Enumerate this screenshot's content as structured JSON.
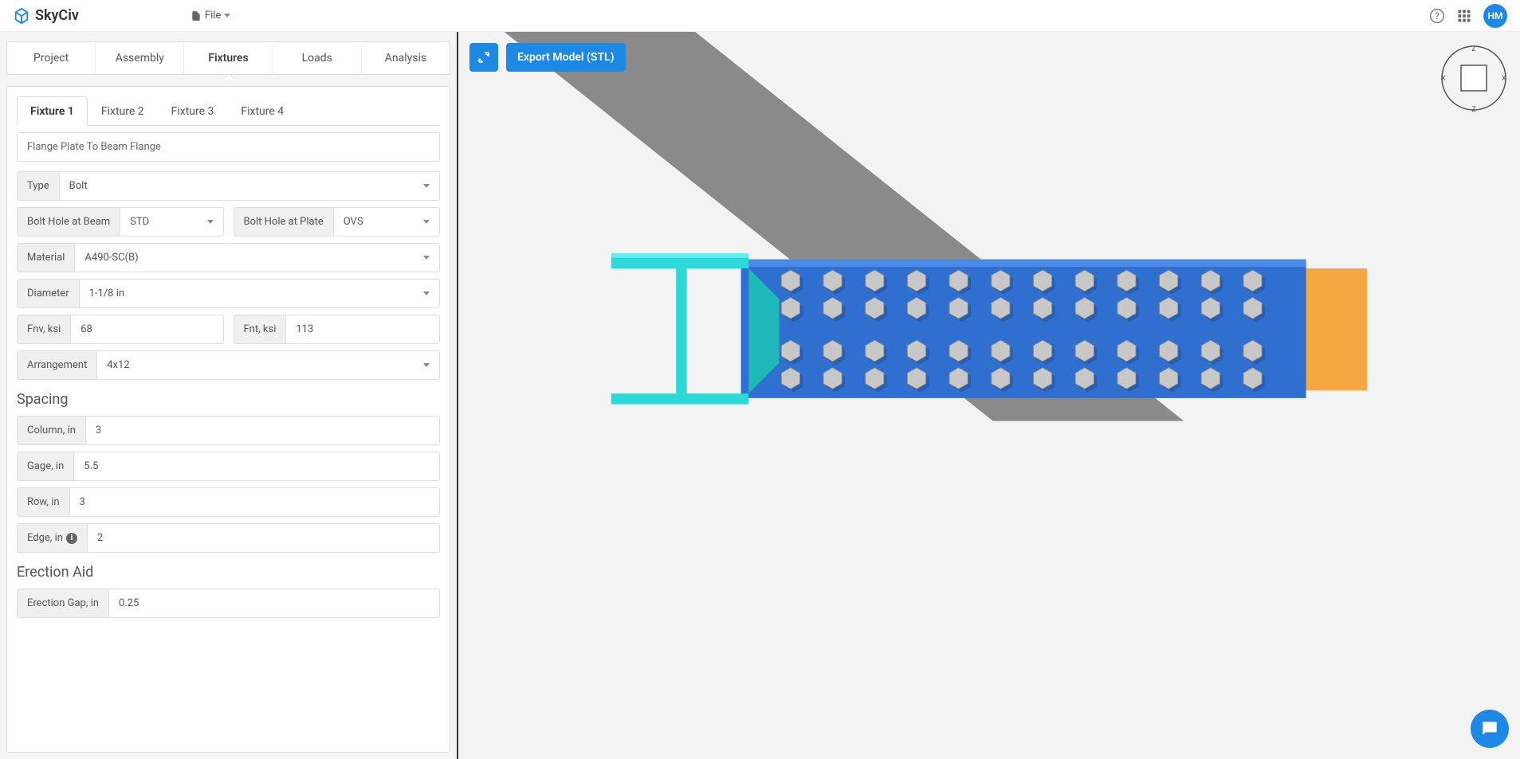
{
  "brand": "SkyCiv",
  "file_menu": "File",
  "avatar_initials": "HM",
  "export_button": "Export Model (STL)",
  "main_tabs": [
    {
      "label": "Project",
      "active": false
    },
    {
      "label": "Assembly",
      "active": false
    },
    {
      "label": "Fixtures",
      "active": true
    },
    {
      "label": "Loads",
      "active": false
    },
    {
      "label": "Analysis",
      "active": false
    }
  ],
  "sub_tabs": [
    {
      "label": "Fixture 1",
      "active": true
    },
    {
      "label": "Fixture 2",
      "active": false
    },
    {
      "label": "Fixture 3",
      "active": false
    },
    {
      "label": "Fixture 4",
      "active": false
    }
  ],
  "fixture_description": "Flange Plate To Beam Flange",
  "fields": {
    "type_label": "Type",
    "type_value": "Bolt",
    "bolt_hole_beam_label": "Bolt Hole at Beam",
    "bolt_hole_beam_value": "STD",
    "bolt_hole_plate_label": "Bolt Hole at Plate",
    "bolt_hole_plate_value": "OVS",
    "material_label": "Material",
    "material_value": "A490-SC(B)",
    "diameter_label": "Diameter",
    "diameter_value": "1-1/8 in",
    "fnv_label": "Fnv, ksi",
    "fnv_value": "68",
    "fnt_label": "Fnt, ksi",
    "fnt_value": "113",
    "arrangement_label": "Arrangement",
    "arrangement_value": "4x12"
  },
  "spacing": {
    "header": "Spacing",
    "column_label": "Column, in",
    "column_value": "3",
    "gage_label": "Gage, in",
    "gage_value": "5.5",
    "row_label": "Row, in",
    "row_value": "3",
    "edge_label": "Edge, in",
    "edge_value": "2"
  },
  "erection": {
    "header": "Erection Aid",
    "gap_label": "Erection Gap, in",
    "gap_value": "0.25"
  },
  "axis_labels": {
    "top": "Z",
    "bottom": "Z",
    "left": "X",
    "right": "X"
  }
}
